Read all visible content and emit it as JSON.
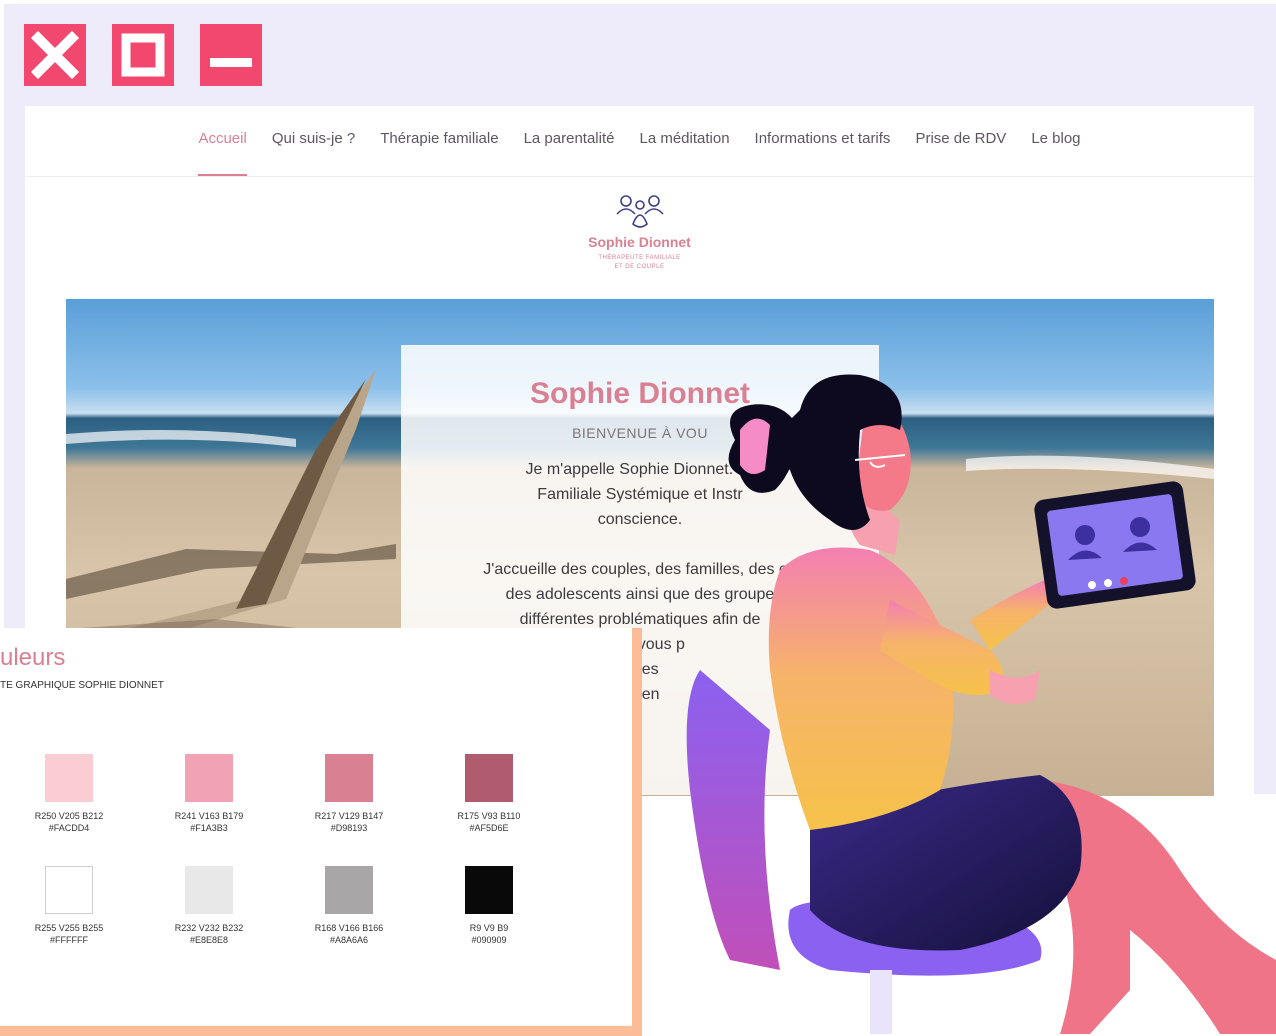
{
  "window_controls": {
    "close_icon": "close-icon",
    "maximize_icon": "maximize-icon",
    "minimize_icon": "minimize-icon",
    "color": "#F2486F"
  },
  "nav": {
    "items": [
      {
        "label": "Accueil",
        "active": true
      },
      {
        "label": "Qui suis-je ?"
      },
      {
        "label": "Thérapie familiale"
      },
      {
        "label": "La parentalité"
      },
      {
        "label": "La méditation"
      },
      {
        "label": "Informations et tarifs"
      },
      {
        "label": "Prise de RDV"
      },
      {
        "label": "Le blog"
      }
    ]
  },
  "logo": {
    "name": "Sophie Dionnet",
    "tagline_1": "THÉRAPEUTE FAMILIALE",
    "tagline_2": "ET DE COUPLE",
    "icon": "family-icon"
  },
  "hero": {
    "title": "Sophie Dionnet",
    "subtitle": "BIENVENUE À VOU",
    "line1": "Je m'appelle Sophie Dionnet. Je",
    "line2": "Familiale Systémique et Instr",
    "line3": "conscience.",
    "line4": "J'accueille des couples, des familles, des en",
    "line5": "des adolescents ainsi que des groupe",
    "line6": "différentes problématiques afin de",
    "line7": "in qui vous p",
    "line8": "s, les",
    "line9": "ez en"
  },
  "palette": {
    "title": "uleurs",
    "subtitle": "TE GRAPHIQUE SOPHIE DIONNET",
    "swatches": [
      {
        "rgb": "R250 V205 B212",
        "hex": "#FACDD4"
      },
      {
        "rgb": "R241 V163 B179",
        "hex": "#F1A3B3"
      },
      {
        "rgb": "R217 V129 B147",
        "hex": "#D98193"
      },
      {
        "rgb": "R175 V93 B110",
        "hex": "#AF5D6E"
      },
      {
        "rgb": "R255 V255 B255",
        "hex": "#FFFFFF"
      },
      {
        "rgb": "R232 V232 B232",
        "hex": "#E8E8E8"
      },
      {
        "rgb": "R168 V166 B166",
        "hex": "#A8A6A6"
      },
      {
        "rgb": "R9 V9 B9",
        "hex": "#090909"
      }
    ]
  },
  "illustration": {
    "icon": "woman-video-call-illustration"
  }
}
